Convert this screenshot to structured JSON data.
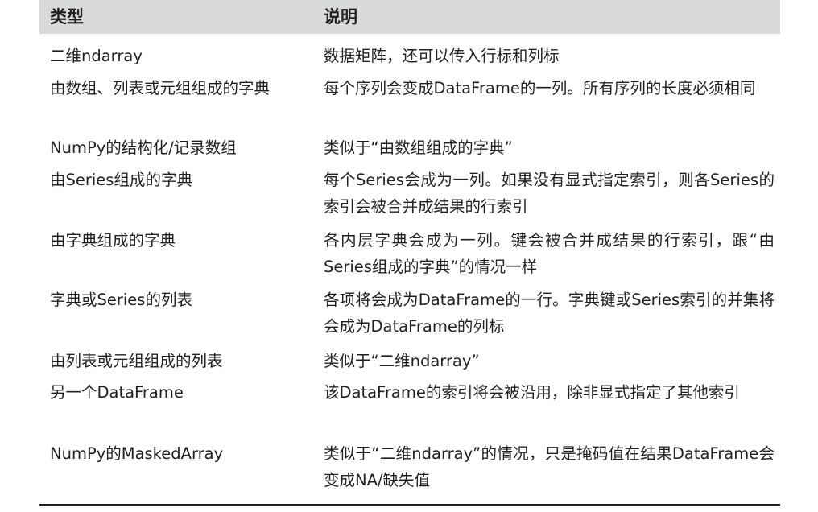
{
  "table": {
    "headers": {
      "type": "类型",
      "description": "说明"
    },
    "rows": [
      {
        "type": "二维ndarray",
        "description": "数据矩阵，还可以传入行标和列标"
      },
      {
        "type": "由数组、列表或元组组成的字典",
        "description": "每个序列会变成DataFrame的一列。所有序列的长度必须相同"
      },
      {
        "type": "NumPy的结构化/记录数组",
        "description": "类似于“由数组组成的字典”"
      },
      {
        "type": "由Series组成的字典",
        "description": "每个Series会成为一列。如果没有显式指定索引，则各Series的索引会被合并成结果的行索引"
      },
      {
        "type": "由字典组成的字典",
        "description": "各内层字典会成为一列。键会被合并成结果的行索引，跟“由Series组成的字典”的情况一样"
      },
      {
        "type": "字典或Series的列表",
        "description": "各项将会成为DataFrame的一行。字典键或Series索引的并集将会成为DataFrame的列标"
      },
      {
        "type": "由列表或元组组成的列表",
        "description": "类似于“二维ndarray”"
      },
      {
        "type": "另一个DataFrame",
        "description": "该DataFrame的索引将会被沿用，除非显式指定了其他索引"
      },
      {
        "type": "NumPy的MaskedArray",
        "description": "类似于“二维ndarray”的情况，只是掩码值在结果DataFrame会变成NA/缺失值"
      }
    ]
  },
  "colors": {
    "header_background": "#d9dadb",
    "text": "#231f20",
    "rule": "#231f20"
  }
}
